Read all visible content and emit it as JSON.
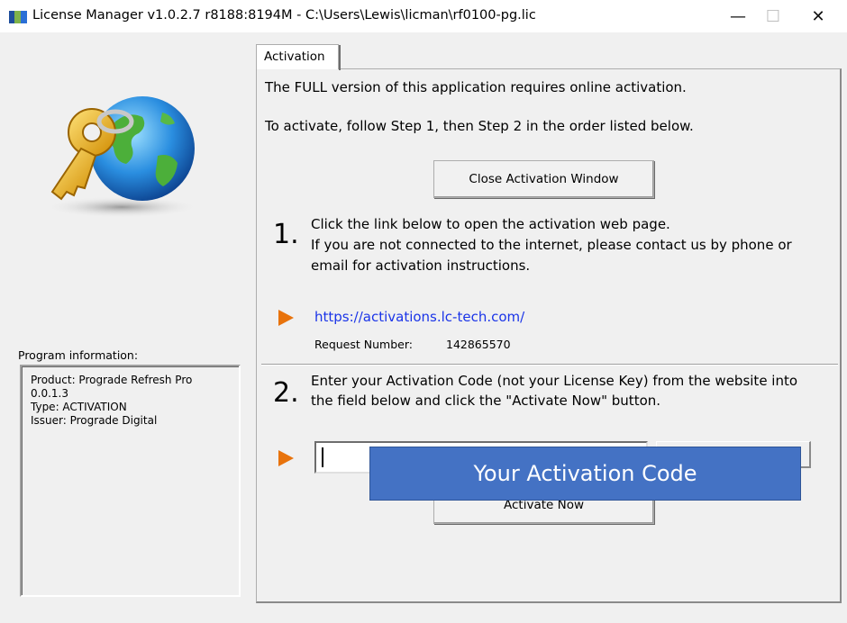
{
  "window": {
    "title": "License Manager v1.0.2.7 r8188:8194M - C:\\Users\\Lewis\\licman\\rf0100-pg.lic",
    "minimize_glyph": "—",
    "maximize_glyph": "☐",
    "close_glyph": "✕"
  },
  "left": {
    "logo_icon": "key-globe-icon",
    "program_info_label": "Program information:",
    "program_info_lines": [
      "Product: Prograde Refresh Pro",
      "0.0.1.3",
      "Type: ACTIVATION",
      "Issuer: Prograde Digital"
    ]
  },
  "tab": {
    "label": "Activation"
  },
  "panel": {
    "intro_line1": "The FULL version of this application requires online activation.",
    "intro_line2": "To activate, follow Step 1, then Step 2 in the order listed below.",
    "close_button": "Close Activation Window",
    "step1": {
      "number": "1.",
      "line1": "Click the link below to open the activation web page.",
      "line2": "If you are not connected to the internet, please contact us by phone or",
      "line3": "email for activation instructions.",
      "link": "https://activations.lc-tech.com/",
      "request_label": "Request Number:",
      "request_value": "142865570"
    },
    "step2": {
      "number": "2.",
      "line1": "Enter your Activation Code (not your License Key) from the website into",
      "line2": "the field below and click the \"Activate Now\" button.",
      "activate_button": "Activate Now",
      "code_value": ""
    },
    "overlay_text": "Your Activation Code"
  },
  "colors": {
    "arrow": "#e8730c",
    "link": "#1a34e8",
    "overlay": "#4472c4"
  }
}
